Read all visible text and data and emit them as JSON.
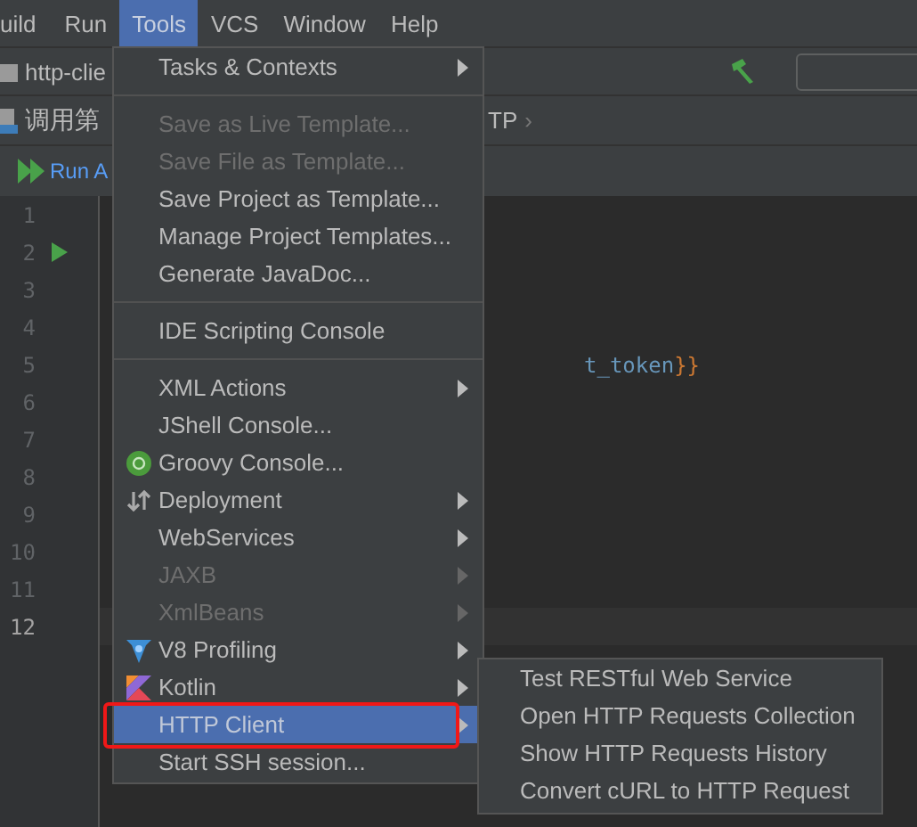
{
  "menu_bar": [
    {
      "label": "uild",
      "selected": false
    },
    {
      "label": "Run",
      "selected": false
    },
    {
      "label": "Tools",
      "selected": true
    },
    {
      "label": "VCS",
      "selected": false
    },
    {
      "label": "Window",
      "selected": false
    },
    {
      "label": "Help",
      "selected": false
    }
  ],
  "navigation_bar": {
    "project": "http-clie"
  },
  "editor_tab": {
    "title": "调用第",
    "breadcrumb": "TP",
    "separator": "›"
  },
  "run_bar": {
    "label": "Run A"
  },
  "editor": {
    "lines": [
      {
        "number": "1",
        "current": false,
        "runnable": false
      },
      {
        "number": "2",
        "current": false,
        "runnable": true
      },
      {
        "number": "3",
        "current": false,
        "runnable": false
      },
      {
        "number": "4",
        "current": false,
        "runnable": false
      },
      {
        "number": "5",
        "current": false,
        "runnable": false,
        "code": [
          {
            "text": "t_token",
            "kind": "variable"
          },
          {
            "text": "}}",
            "kind": "brace"
          }
        ]
      },
      {
        "number": "6",
        "current": false,
        "runnable": false
      },
      {
        "number": "7",
        "current": false,
        "runnable": false
      },
      {
        "number": "8",
        "current": false,
        "runnable": false
      },
      {
        "number": "9",
        "current": false,
        "runnable": false
      },
      {
        "number": "10",
        "current": false,
        "runnable": false
      },
      {
        "number": "11",
        "current": false,
        "runnable": false
      },
      {
        "number": "12",
        "current": true,
        "runnable": false
      }
    ]
  },
  "tools_menu": {
    "items": [
      {
        "kind": "item",
        "label": "Tasks & Contexts",
        "disabled": false,
        "submenu": true,
        "selected": false
      },
      {
        "kind": "separator"
      },
      {
        "kind": "item",
        "label": "Save as Live Template...",
        "disabled": true,
        "submenu": false,
        "selected": false
      },
      {
        "kind": "item",
        "label": "Save File as Template...",
        "disabled": true,
        "submenu": false,
        "selected": false
      },
      {
        "kind": "item",
        "label": "Save Project as Template...",
        "disabled": false,
        "submenu": false,
        "selected": false
      },
      {
        "kind": "item",
        "label": "Manage Project Templates...",
        "disabled": false,
        "submenu": false,
        "selected": false
      },
      {
        "kind": "item",
        "label": "Generate JavaDoc...",
        "disabled": false,
        "submenu": false,
        "selected": false
      },
      {
        "kind": "separator"
      },
      {
        "kind": "item",
        "label": "IDE Scripting Console",
        "disabled": false,
        "submenu": false,
        "selected": false
      },
      {
        "kind": "separator"
      },
      {
        "kind": "item",
        "label": "XML Actions",
        "disabled": false,
        "submenu": true,
        "selected": false
      },
      {
        "kind": "item",
        "label": "JShell Console...",
        "disabled": false,
        "submenu": false,
        "selected": false
      },
      {
        "kind": "item",
        "label": "Groovy Console...",
        "disabled": false,
        "submenu": false,
        "selected": false
      },
      {
        "kind": "item",
        "label": "Deployment",
        "disabled": false,
        "submenu": true,
        "selected": false
      },
      {
        "kind": "item",
        "label": "WebServices",
        "disabled": false,
        "submenu": true,
        "selected": false
      },
      {
        "kind": "item",
        "label": "JAXB",
        "disabled": true,
        "submenu": true,
        "selected": false
      },
      {
        "kind": "item",
        "label": "XmlBeans",
        "disabled": true,
        "submenu": true,
        "selected": false
      },
      {
        "kind": "item",
        "label": "V8 Profiling",
        "disabled": false,
        "submenu": true,
        "selected": false
      },
      {
        "kind": "item",
        "label": "Kotlin",
        "disabled": false,
        "submenu": true,
        "selected": false
      },
      {
        "kind": "item",
        "label": "HTTP Client",
        "disabled": false,
        "submenu": true,
        "selected": true,
        "highlighted": true
      },
      {
        "kind": "item",
        "label": "Start SSH session...",
        "disabled": false,
        "submenu": false,
        "selected": false
      }
    ]
  },
  "http_client_submenu": {
    "items": [
      {
        "label": "Test RESTful Web Service"
      },
      {
        "label": "Open HTTP Requests Collection"
      },
      {
        "label": "Show HTTP Requests History"
      },
      {
        "label": "Convert cURL to HTTP Request"
      }
    ]
  }
}
